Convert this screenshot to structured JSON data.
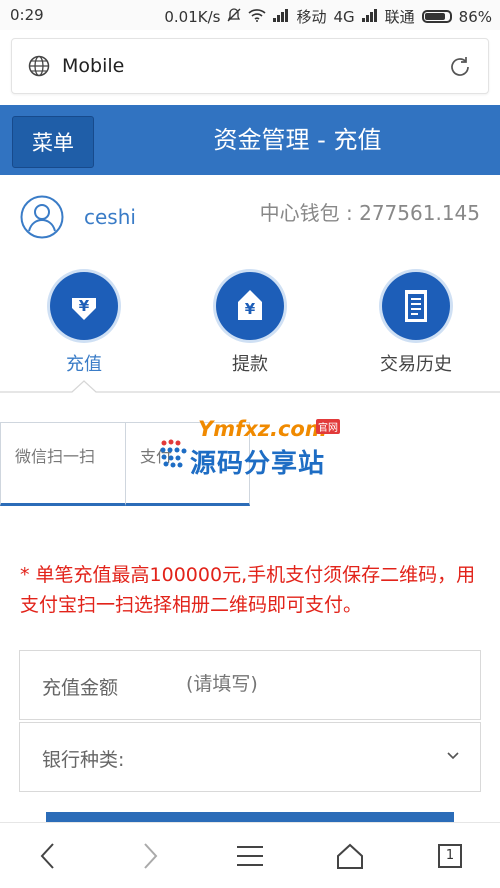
{
  "status_bar": {
    "time": "0:29",
    "speed": "0.01K/s",
    "carrier1": "移动",
    "network1": "4G",
    "carrier2": "联通",
    "battery": "86%"
  },
  "url_bar": {
    "text": "Mobile",
    "icons": [
      "globe-icon",
      "reload-icon"
    ]
  },
  "header": {
    "menu_label": "菜单",
    "title": "资金管理 - 充值",
    "color": "#3173c1"
  },
  "user": {
    "name": "ceshi",
    "wallet_label": "中心钱包 : 277561.145"
  },
  "actions": [
    {
      "label": "充值",
      "icon": "deposit-yen-icon",
      "active": true
    },
    {
      "label": "提款",
      "icon": "withdraw-yen-icon",
      "active": false
    },
    {
      "label": "交易历史",
      "icon": "history-list-icon",
      "active": false
    }
  ],
  "pay_tabs": [
    {
      "label": "微信扫一扫"
    },
    {
      "label": "支付"
    }
  ],
  "watermark": {
    "top": "Ymfxz.com",
    "badge": "官网",
    "main": "源码分享站"
  },
  "notice": "* 单笔充值最高100000元,手机支付须保存二维码，用支付宝扫一扫选择相册二维码即可支付。",
  "form": {
    "amount_label": "充值金额",
    "amount_placeholder": "(请填写)",
    "bank_label": "银行种类:"
  },
  "bottom_nav": {
    "tab_count": "1"
  }
}
